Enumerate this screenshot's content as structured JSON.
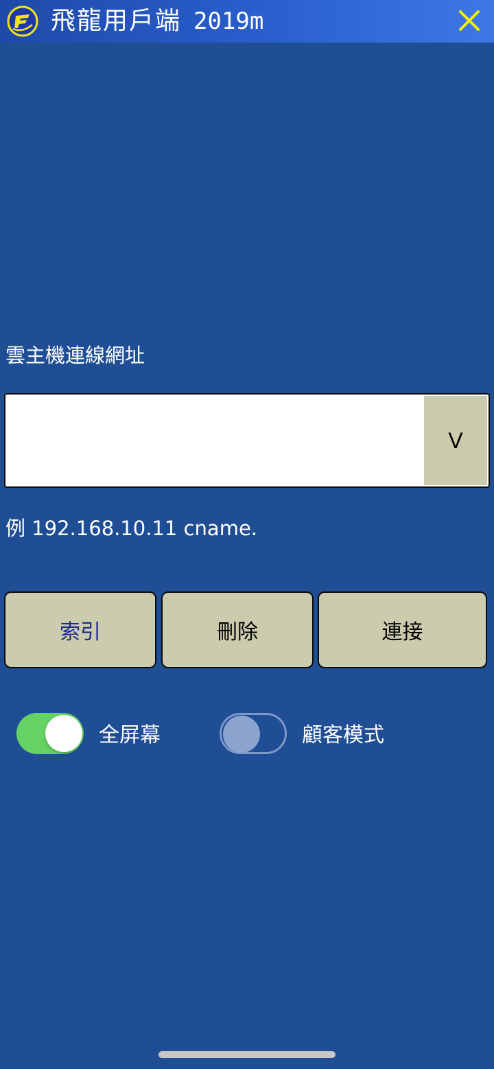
{
  "titlebar": {
    "app_name": "飛龍用戶端",
    "version": "2019m",
    "logo_icon": "app-logo-icon",
    "close_icon": "close-icon",
    "bg_color": "#2a5fcf",
    "close_color": "#f4f000"
  },
  "connection": {
    "section_label": "雲主機連線網址",
    "url_value": "",
    "url_placeholder": "",
    "dropdown_label": "V",
    "example_hint": "例 192.168.10.11 cname."
  },
  "actions": {
    "search_label": "索引",
    "delete_label": "刪除",
    "connect_label": "連接"
  },
  "options": {
    "fullscreen": {
      "label": "全屏幕",
      "enabled": true
    },
    "guest_mode": {
      "label": "顧客模式",
      "enabled": false
    }
  },
  "theme": {
    "background": "#1f4e95",
    "button_fill": "#cbcbad",
    "toggle_on": "#65d364"
  }
}
